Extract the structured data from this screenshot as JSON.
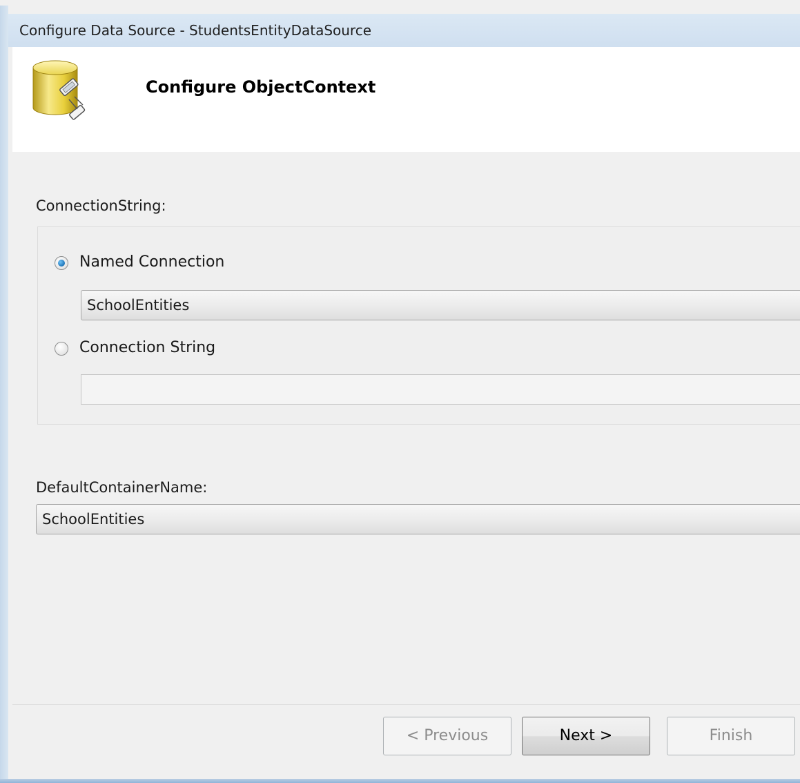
{
  "window": {
    "title": "Configure Data Source - StudentsEntityDataSource"
  },
  "header": {
    "icon": "database-icon",
    "title": "Configure ObjectContext"
  },
  "connection": {
    "section_label": "ConnectionString:",
    "named_option_label": "Named Connection",
    "named_option_selected": true,
    "named_value": "SchoolEntities",
    "string_option_label": "Connection String",
    "string_option_selected": false,
    "string_value": ""
  },
  "container": {
    "label": "DefaultContainerName:",
    "value": "SchoolEntities"
  },
  "footer": {
    "previous_label": "< Previous",
    "next_label": "Next >",
    "finish_label": "Finish"
  },
  "colors": {
    "title_bar": "#cfdff0",
    "radio_selected": "#1f75b8",
    "dialog_background": "#f0f0f0"
  }
}
